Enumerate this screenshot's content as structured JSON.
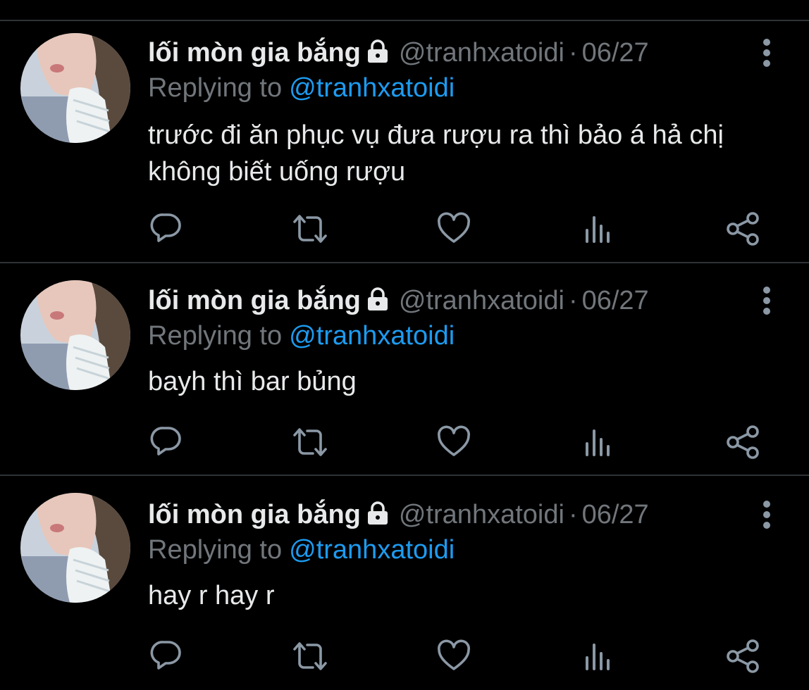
{
  "colors": {
    "background": "#000000",
    "text_primary": "#e7e9ea",
    "text_secondary": "#71767b",
    "link": "#1d9bf0",
    "divider": "#2f3336"
  },
  "tweets": [
    {
      "author_name": "lối mòn gia bắng",
      "handle": "@tranhxatoidi",
      "separator": "·",
      "date": "06/27",
      "replying_label": "Replying to",
      "replying_handle": "@tranhxatoidi",
      "text": "trước đi ăn phục vụ đưa rượu ra thì bảo á hả chị không biết uống rượu",
      "icons": [
        "lock-icon",
        "more-icon",
        "reply-icon",
        "retweet-icon",
        "like-icon",
        "views-icon",
        "share-icon"
      ]
    },
    {
      "author_name": "lối mòn gia bắng",
      "handle": "@tranhxatoidi",
      "separator": "·",
      "date": "06/27",
      "replying_label": "Replying to",
      "replying_handle": "@tranhxatoidi",
      "text": "bayh thì bar bủng",
      "icons": [
        "lock-icon",
        "more-icon",
        "reply-icon",
        "retweet-icon",
        "like-icon",
        "views-icon",
        "share-icon"
      ]
    },
    {
      "author_name": "lối mòn gia bắng",
      "handle": "@tranhxatoidi",
      "separator": "·",
      "date": "06/27",
      "replying_label": "Replying to",
      "replying_handle": "@tranhxatoidi",
      "text": "hay r hay r",
      "icons": [
        "lock-icon",
        "more-icon",
        "reply-icon",
        "retweet-icon",
        "like-icon",
        "views-icon",
        "share-icon"
      ]
    }
  ]
}
